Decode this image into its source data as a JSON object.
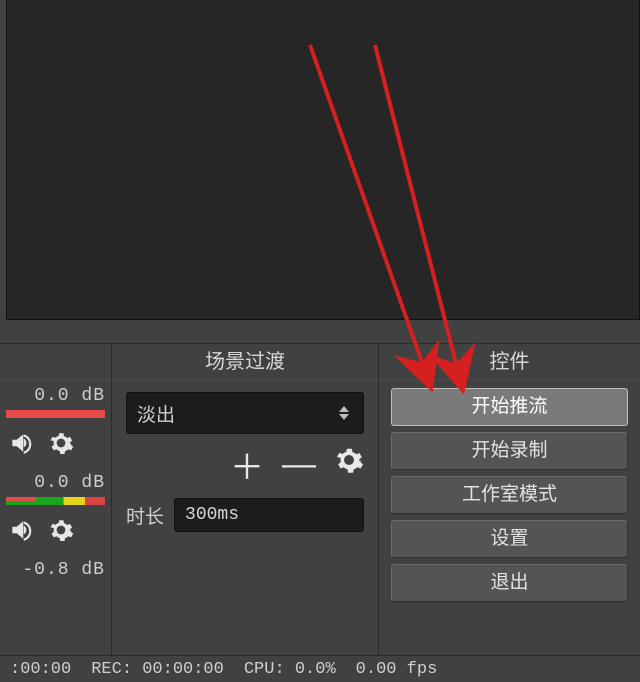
{
  "panels": {
    "transitions": {
      "title": "场景过渡",
      "selected": "淡出",
      "duration_label": "时长",
      "duration_value": "300ms"
    },
    "controls": {
      "title": "控件",
      "buttons": {
        "start_stream": "开始推流",
        "start_record": "开始录制",
        "studio_mode": "工作室模式",
        "settings": "设置",
        "exit": "退出"
      }
    }
  },
  "mixer": {
    "ch1": {
      "db": "0.0 dB"
    },
    "ch2": {
      "db": "0.0 dB"
    },
    "ch3": {
      "db": "-0.8 dB"
    }
  },
  "status": {
    "time": ":00:00",
    "rec": "REC: 00:00:00",
    "cpu": "CPU: 0.0%",
    "fps": "0.00 fps"
  }
}
